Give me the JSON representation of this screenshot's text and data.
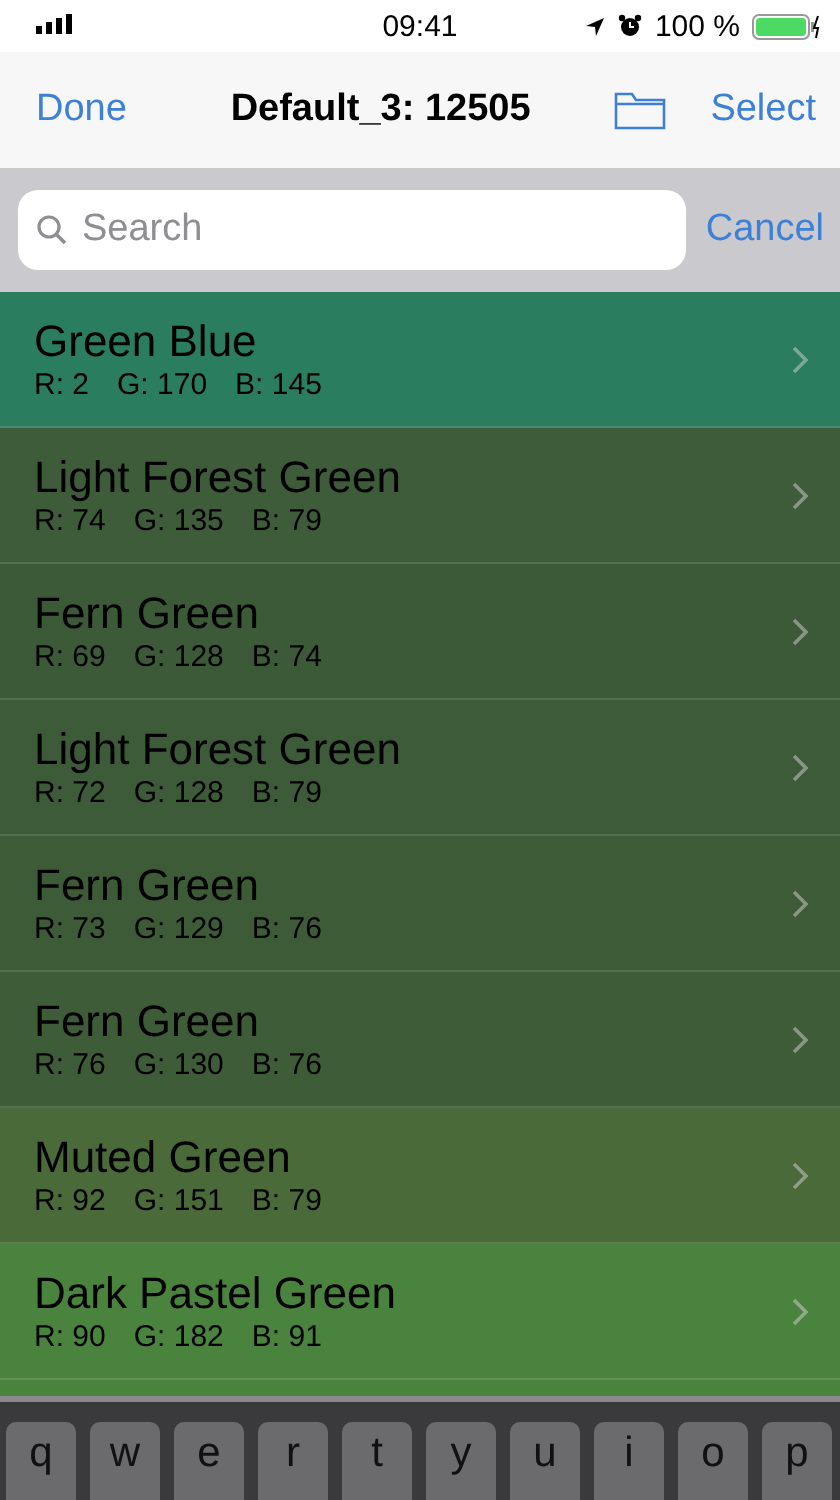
{
  "status_bar": {
    "time": "09:41",
    "battery": "100 %"
  },
  "nav_bar": {
    "left": "Done",
    "title": "Default_3: 12505",
    "right": "Select"
  },
  "search": {
    "placeholder": "Search",
    "cancel": "Cancel"
  },
  "colors": [
    {
      "name": "Green Blue",
      "r": "R: 2",
      "g": "G: 170",
      "b": "B: 145",
      "color": "#2a7d5e"
    },
    {
      "name": "Light Forest Green",
      "r": "R: 74",
      "g": "G: 135",
      "b": "B: 79",
      "color": "#3e5c39"
    },
    {
      "name": "Fern Green",
      "r": "R: 69",
      "g": "G: 128",
      "b": "B: 74",
      "color": "#3c5a37"
    },
    {
      "name": "Light Forest Green",
      "r": "R: 72",
      "g": "G: 128",
      "b": "B: 79",
      "color": "#3d5b39"
    },
    {
      "name": "Fern Green",
      "r": "R: 73",
      "g": "G: 129",
      "b": "B: 76",
      "color": "#3e5b38"
    },
    {
      "name": "Fern Green",
      "r": "R: 76",
      "g": "G: 130",
      "b": "B: 76",
      "color": "#3f5c38"
    },
    {
      "name": "Muted Green",
      "r": "R: 92",
      "g": "G: 151",
      "b": "B: 79",
      "color": "#4a6a3a"
    },
    {
      "name": "Dark Pastel Green",
      "r": "R: 90",
      "g": "G: 182",
      "b": "B: 91",
      "color": "#4a833e"
    }
  ],
  "keyboard": {
    "keys": [
      "q",
      "w",
      "e",
      "r",
      "t",
      "y",
      "u",
      "i",
      "o",
      "p"
    ]
  }
}
